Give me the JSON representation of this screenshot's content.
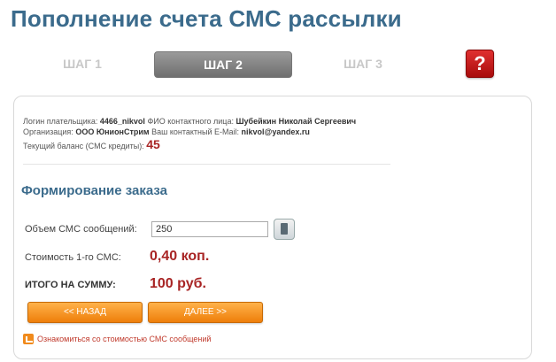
{
  "page": {
    "title": "Пополнение счета СМС рассылки"
  },
  "steps": [
    {
      "label": "ШАГ 1",
      "active": false
    },
    {
      "label": "ШАГ 2",
      "active": true
    },
    {
      "label": "ШАГ 3",
      "active": false
    }
  ],
  "help": {
    "label": "?"
  },
  "info": {
    "login_label": "Логин плательщика:",
    "login_value": "4466_nikvol",
    "contact_label": "ФИО контактного лица:",
    "contact_value": "Шубейкин Николай Сергеевич",
    "org_label": "Организация:",
    "org_value": "ООО ЮнионСтрим",
    "email_label": "Ваш контактный E-Mail:",
    "email_value": "nikvol@yandex.ru",
    "balance_label": "Текущий баланс (СМС кредиты):",
    "balance_value": "45"
  },
  "order": {
    "section_title": "Формирование заказа",
    "qty_label": "Объем СМС сообщений:",
    "qty_value": "250",
    "unit_cost_label": "Стоимость 1-го СМС:",
    "unit_cost_value": "0,40 коп.",
    "total_label": "ИТОГО НА СУММУ:",
    "total_value": "100 руб."
  },
  "buttons": {
    "back_label": "<< НАЗАД",
    "next_label": "ДАЛЕЕ >>"
  },
  "link": {
    "label": "Ознакомиться со стоимостью СМС сообщений"
  },
  "colors": {
    "title": "#3b6b8c",
    "accent": "#a82424",
    "button": "#ee7e0a",
    "help": "#c41a1a"
  }
}
